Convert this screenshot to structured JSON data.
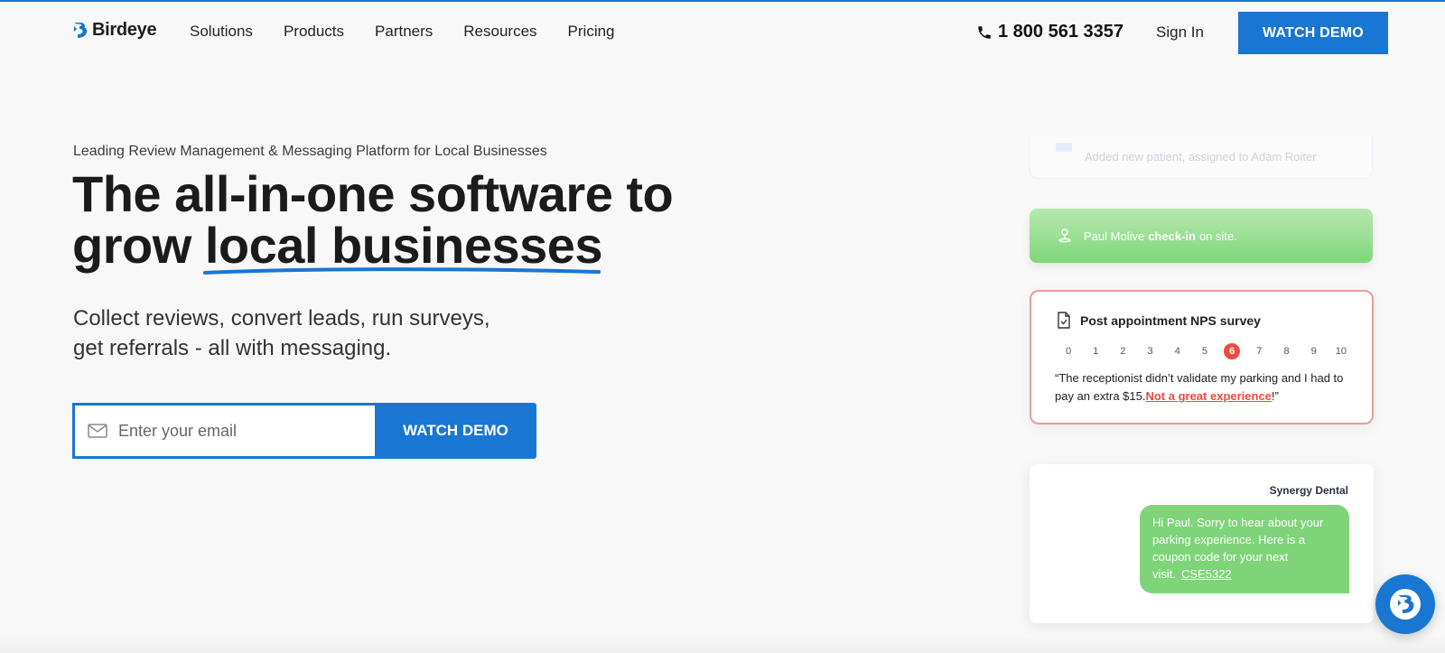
{
  "header": {
    "logo_text": "Birdeye",
    "nav": [
      "Solutions",
      "Products",
      "Partners",
      "Resources",
      "Pricing"
    ],
    "phone": "1 800 561 3357",
    "sign_in": "Sign In",
    "cta": "WATCH DEMO"
  },
  "hero": {
    "eyebrow": "Leading Review Management & Messaging Platform for Local Businesses",
    "headline_line1": "The all-in-one software to",
    "headline_line2_prefix": "grow ",
    "headline_highlight": "local businesses",
    "sub_line1": "Collect reviews, convert leads, run surveys,",
    "sub_line2": "get referrals - all with messaging.",
    "email_placeholder": "Enter your email",
    "form_cta": "WATCH DEMO"
  },
  "cards": {
    "faded_text": "Added new patient, assigned to Adam Roiter",
    "checkin": {
      "name": "Paul Molive",
      "action": "check-in",
      "suffix": "on site."
    },
    "nps": {
      "title": "Post appointment NPS survey",
      "scale": [
        "0",
        "1",
        "2",
        "3",
        "4",
        "5",
        "6",
        "7",
        "8",
        "9",
        "10"
      ],
      "selected": 6,
      "quote_main": "“The receptionist didn’t validate my parking and I had to pay an extra $15.",
      "quote_highlight": "Not a great experience",
      "quote_end": "!”"
    },
    "message": {
      "sender": "Synergy Dental",
      "text": "Hi Paul. Sorry to hear about your parking experience. Here is a coupon code for your next visit.",
      "code": "CSE5322"
    }
  },
  "colors": {
    "brand_blue": "#1976d2",
    "green": "#7fd47a",
    "red": "#ec4b3e"
  },
  "icons": [
    "birdeye-logo-icon",
    "phone-icon",
    "mail-icon",
    "pin-icon",
    "survey-doc-icon",
    "chat-launcher-icon"
  ]
}
